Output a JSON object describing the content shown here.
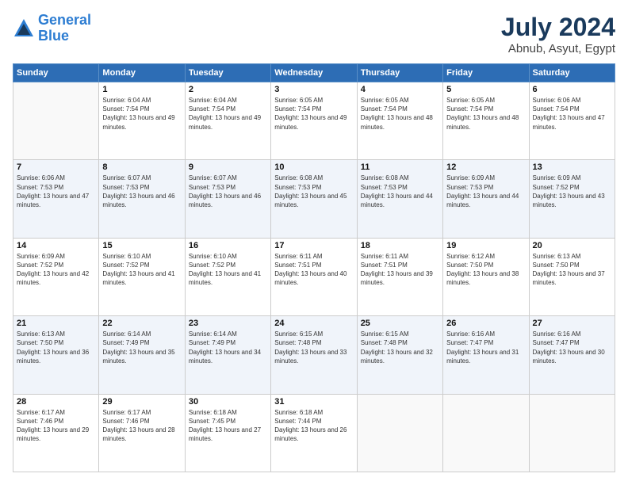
{
  "logo": {
    "line1": "General",
    "line2": "Blue"
  },
  "title": "July 2024",
  "subtitle": "Abnub, Asyut, Egypt",
  "days_of_week": [
    "Sunday",
    "Monday",
    "Tuesday",
    "Wednesday",
    "Thursday",
    "Friday",
    "Saturday"
  ],
  "weeks": [
    [
      {
        "day": "",
        "info": ""
      },
      {
        "day": "1",
        "info": "Sunrise: 6:04 AM\nSunset: 7:54 PM\nDaylight: 13 hours and 49 minutes."
      },
      {
        "day": "2",
        "info": "Sunrise: 6:04 AM\nSunset: 7:54 PM\nDaylight: 13 hours and 49 minutes."
      },
      {
        "day": "3",
        "info": "Sunrise: 6:05 AM\nSunset: 7:54 PM\nDaylight: 13 hours and 49 minutes."
      },
      {
        "day": "4",
        "info": "Sunrise: 6:05 AM\nSunset: 7:54 PM\nDaylight: 13 hours and 48 minutes."
      },
      {
        "day": "5",
        "info": "Sunrise: 6:05 AM\nSunset: 7:54 PM\nDaylight: 13 hours and 48 minutes."
      },
      {
        "day": "6",
        "info": "Sunrise: 6:06 AM\nSunset: 7:54 PM\nDaylight: 13 hours and 47 minutes."
      }
    ],
    [
      {
        "day": "7",
        "info": "Sunrise: 6:06 AM\nSunset: 7:53 PM\nDaylight: 13 hours and 47 minutes."
      },
      {
        "day": "8",
        "info": "Sunrise: 6:07 AM\nSunset: 7:53 PM\nDaylight: 13 hours and 46 minutes."
      },
      {
        "day": "9",
        "info": "Sunrise: 6:07 AM\nSunset: 7:53 PM\nDaylight: 13 hours and 46 minutes."
      },
      {
        "day": "10",
        "info": "Sunrise: 6:08 AM\nSunset: 7:53 PM\nDaylight: 13 hours and 45 minutes."
      },
      {
        "day": "11",
        "info": "Sunrise: 6:08 AM\nSunset: 7:53 PM\nDaylight: 13 hours and 44 minutes."
      },
      {
        "day": "12",
        "info": "Sunrise: 6:09 AM\nSunset: 7:53 PM\nDaylight: 13 hours and 44 minutes."
      },
      {
        "day": "13",
        "info": "Sunrise: 6:09 AM\nSunset: 7:52 PM\nDaylight: 13 hours and 43 minutes."
      }
    ],
    [
      {
        "day": "14",
        "info": "Sunrise: 6:09 AM\nSunset: 7:52 PM\nDaylight: 13 hours and 42 minutes."
      },
      {
        "day": "15",
        "info": "Sunrise: 6:10 AM\nSunset: 7:52 PM\nDaylight: 13 hours and 41 minutes."
      },
      {
        "day": "16",
        "info": "Sunrise: 6:10 AM\nSunset: 7:52 PM\nDaylight: 13 hours and 41 minutes."
      },
      {
        "day": "17",
        "info": "Sunrise: 6:11 AM\nSunset: 7:51 PM\nDaylight: 13 hours and 40 minutes."
      },
      {
        "day": "18",
        "info": "Sunrise: 6:11 AM\nSunset: 7:51 PM\nDaylight: 13 hours and 39 minutes."
      },
      {
        "day": "19",
        "info": "Sunrise: 6:12 AM\nSunset: 7:50 PM\nDaylight: 13 hours and 38 minutes."
      },
      {
        "day": "20",
        "info": "Sunrise: 6:13 AM\nSunset: 7:50 PM\nDaylight: 13 hours and 37 minutes."
      }
    ],
    [
      {
        "day": "21",
        "info": "Sunrise: 6:13 AM\nSunset: 7:50 PM\nDaylight: 13 hours and 36 minutes."
      },
      {
        "day": "22",
        "info": "Sunrise: 6:14 AM\nSunset: 7:49 PM\nDaylight: 13 hours and 35 minutes."
      },
      {
        "day": "23",
        "info": "Sunrise: 6:14 AM\nSunset: 7:49 PM\nDaylight: 13 hours and 34 minutes."
      },
      {
        "day": "24",
        "info": "Sunrise: 6:15 AM\nSunset: 7:48 PM\nDaylight: 13 hours and 33 minutes."
      },
      {
        "day": "25",
        "info": "Sunrise: 6:15 AM\nSunset: 7:48 PM\nDaylight: 13 hours and 32 minutes."
      },
      {
        "day": "26",
        "info": "Sunrise: 6:16 AM\nSunset: 7:47 PM\nDaylight: 13 hours and 31 minutes."
      },
      {
        "day": "27",
        "info": "Sunrise: 6:16 AM\nSunset: 7:47 PM\nDaylight: 13 hours and 30 minutes."
      }
    ],
    [
      {
        "day": "28",
        "info": "Sunrise: 6:17 AM\nSunset: 7:46 PM\nDaylight: 13 hours and 29 minutes."
      },
      {
        "day": "29",
        "info": "Sunrise: 6:17 AM\nSunset: 7:46 PM\nDaylight: 13 hours and 28 minutes."
      },
      {
        "day": "30",
        "info": "Sunrise: 6:18 AM\nSunset: 7:45 PM\nDaylight: 13 hours and 27 minutes."
      },
      {
        "day": "31",
        "info": "Sunrise: 6:18 AM\nSunset: 7:44 PM\nDaylight: 13 hours and 26 minutes."
      },
      {
        "day": "",
        "info": ""
      },
      {
        "day": "",
        "info": ""
      },
      {
        "day": "",
        "info": ""
      }
    ]
  ]
}
